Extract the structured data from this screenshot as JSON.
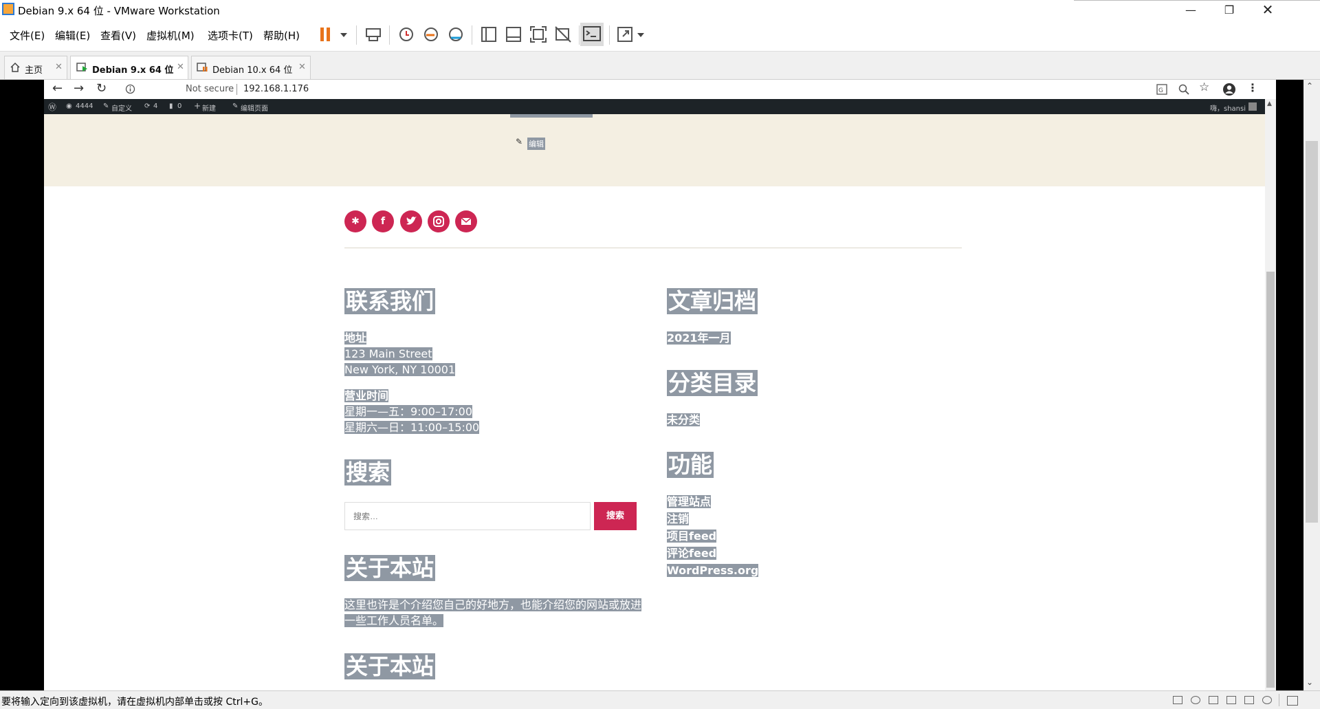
{
  "window": {
    "title": "Debian 9.x 64 位 - VMware Workstation"
  },
  "menu": [
    "文件(E)",
    "编辑(E)",
    "查看(V)",
    "虚拟机(M)",
    "选项卡(T)",
    "帮助(H)"
  ],
  "tabs": [
    {
      "label": "主页"
    },
    {
      "label": "Debian 9.x 64 位"
    },
    {
      "label": "Debian 10.x 64 位"
    }
  ],
  "browser": {
    "security": "Not secure",
    "url": "192.168.1.176"
  },
  "wp_admin_bar": {
    "site": "4444",
    "customize": "自定义",
    "updates": "4",
    "comments": "0",
    "new": "新建",
    "edit_page": "编辑页面",
    "greeting": "嗨，shansi"
  },
  "page": {
    "edit_link": "编辑",
    "contact": {
      "title": "联系我们",
      "address_label": "地址",
      "address_line1": "123 Main Street",
      "address_line2": "New York, NY 10001",
      "hours_label": "营业时间",
      "hours_line1": "星期一—五：9:00–17:00",
      "hours_line2": "星期六—日：11:00–15:00"
    },
    "search": {
      "title": "搜索",
      "placeholder": "搜索…",
      "button": "搜索"
    },
    "about": {
      "title": "关于本站",
      "text_line1": "这里也许是个介绍您自己的好地方，也能介绍您的网站或放进",
      "text_line2": "一些工作人员名单。"
    },
    "about2_title": "关于本站",
    "archives": {
      "title": "文章归档",
      "item": "2021年一月"
    },
    "categories": {
      "title": "分类目录",
      "item": "未分类"
    },
    "meta": {
      "title": "功能",
      "items": [
        "管理站点",
        "注销",
        "项目feed",
        "评论feed",
        "WordPress.org"
      ]
    }
  },
  "status": {
    "message": "要将输入定向到该虚拟机，请在虚拟机内部单击或按 Ctrl+G。"
  },
  "colors": {
    "accent": "#cd2653",
    "selection": "#8f98a3",
    "admin_bar": "#1d2327",
    "footer_bg": "#f4efe2"
  }
}
